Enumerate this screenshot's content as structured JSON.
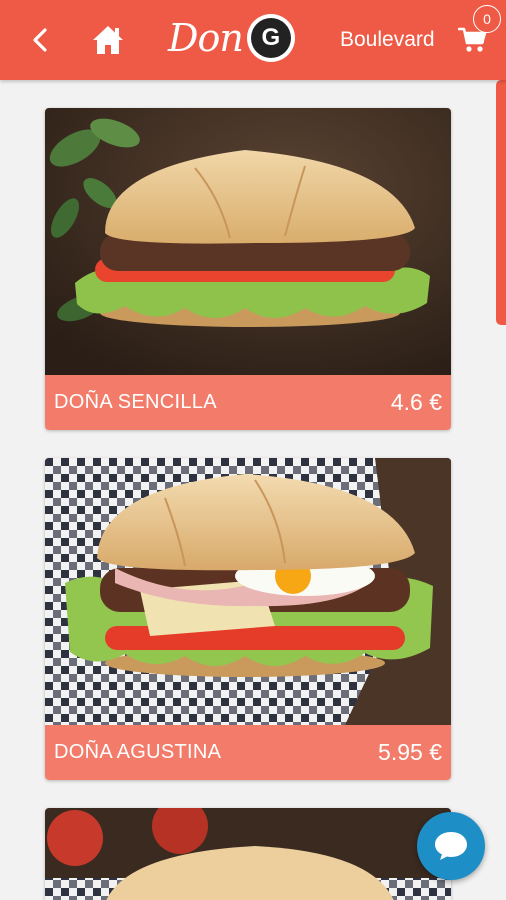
{
  "header": {
    "logo_text": "Don",
    "logo_letter": "G",
    "store_name": "Boulevard",
    "cart_count": "0"
  },
  "products": [
    {
      "name": "DOÑA SENCILLA",
      "price": "4.6 €"
    },
    {
      "name": "DOÑA AGUSTINA",
      "price": "5.95 €"
    }
  ],
  "icons": {
    "back": "chevron-left-icon",
    "home": "home-icon",
    "cart": "cart-icon",
    "chat": "chat-bubble-icon"
  },
  "colors": {
    "header": "#ee5a45",
    "card_footer": "#f27b6a",
    "chat_button": "#1e8fc6"
  }
}
